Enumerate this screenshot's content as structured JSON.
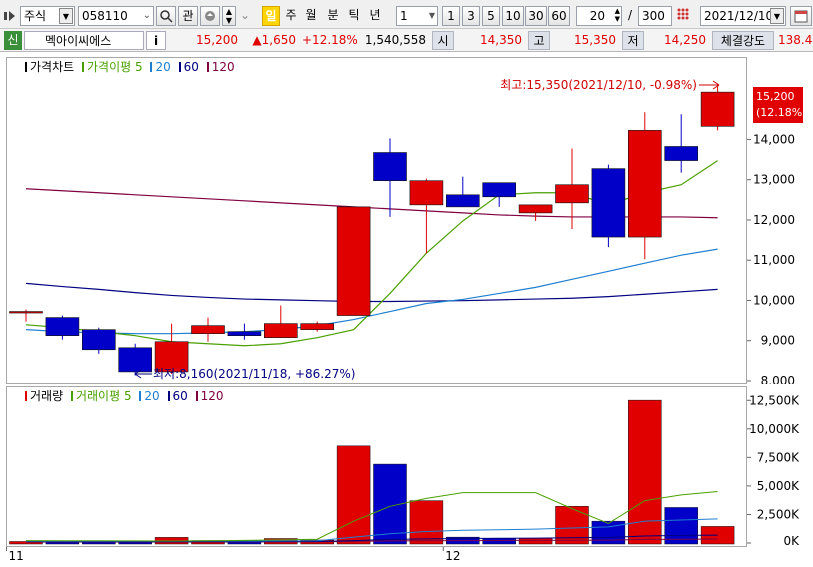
{
  "toolbar": {
    "market": "주식",
    "code": "058110",
    "fav_label": "관",
    "period_buttons": [
      "일",
      "주",
      "월",
      "분",
      "틱",
      "년"
    ],
    "interval_value": "1",
    "interval_buttons": [
      "1",
      "3",
      "5",
      "10",
      "30",
      "60"
    ],
    "display_count": "20",
    "separator": "/",
    "total_count": "300",
    "date": "2021/12/10"
  },
  "quote": {
    "badge": "신",
    "name": "멕아이씨에스",
    "info_btn": "i",
    "price": "15,200",
    "change": "▲1,650",
    "change_pct": "+12.18%",
    "volume": "1,540,558",
    "open_label": "시",
    "open": "14,350",
    "high_label": "고",
    "high": "15,350",
    "low_label": "저",
    "low": "14,250",
    "strength_label": "체결강도",
    "strength": "138.4"
  },
  "colors": {
    "up": "#e00000",
    "down": "#0000c8",
    "ma5": "#4aa000",
    "ma20": "#1e7fd0",
    "ma60": "#000080",
    "ma120": "#800040"
  },
  "chart_data": [
    {
      "type": "candlestick",
      "legend": {
        "title": "가격차트",
        "ma_prefix": "가격이평",
        "periods": [
          "5",
          "20",
          "60",
          "120"
        ]
      },
      "y_ticks": [
        "15,200",
        "14,000",
        "13,000",
        "12,000",
        "11,000",
        "10,000",
        "9,000",
        "8,000"
      ],
      "ylim": [
        7950,
        15700
      ],
      "current_price": "15,200",
      "current_pct": "(12.18%)",
      "high_annotation": "최고:15,350(2021/12/10, -0.98%)",
      "low_annotation": "최저:8,160(2021/11/18, +86.27%)",
      "candles": [
        {
          "o": 9750,
          "h": 9800,
          "l": 9500,
          "c": 9750
        },
        {
          "o": 9600,
          "h": 9650,
          "l": 9050,
          "c": 9150
        },
        {
          "o": 9300,
          "h": 9350,
          "l": 8700,
          "c": 8800
        },
        {
          "o": 8850,
          "h": 8950,
          "l": 8160,
          "c": 8250
        },
        {
          "o": 8250,
          "h": 9450,
          "l": 8200,
          "c": 9000
        },
        {
          "o": 9200,
          "h": 9600,
          "l": 9000,
          "c": 9400
        },
        {
          "o": 9250,
          "h": 9450,
          "l": 9050,
          "c": 9150
        },
        {
          "o": 9100,
          "h": 9900,
          "l": 9100,
          "c": 9450
        },
        {
          "o": 9300,
          "h": 9500,
          "l": 9250,
          "c": 9450
        },
        {
          "o": 9650,
          "h": 12350,
          "l": 9650,
          "c": 12350
        },
        {
          "o": 13700,
          "h": 14050,
          "l": 12100,
          "c": 13000
        },
        {
          "o": 12400,
          "h": 13050,
          "l": 11200,
          "c": 13000
        },
        {
          "o": 12650,
          "h": 13100,
          "l": 12350,
          "c": 12350
        },
        {
          "o": 12950,
          "h": 12950,
          "l": 12350,
          "c": 12600
        },
        {
          "o": 12200,
          "h": 12400,
          "l": 12000,
          "c": 12400
        },
        {
          "o": 12450,
          "h": 13800,
          "l": 11800,
          "c": 12900
        },
        {
          "o": 13300,
          "h": 13400,
          "l": 11350,
          "c": 11600
        },
        {
          "o": 11600,
          "h": 14700,
          "l": 11050,
          "c": 14250
        },
        {
          "o": 13850,
          "h": 14650,
          "l": 13200,
          "c": 13500
        },
        {
          "o": 14350,
          "h": 15350,
          "l": 14250,
          "c": 15200
        }
      ],
      "ma5": [
        9420,
        9350,
        9250,
        9150,
        9000,
        8950,
        8900,
        8950,
        9100,
        9300,
        10200,
        11200,
        12000,
        12650,
        12700,
        12700,
        12400,
        12700,
        12900,
        13500
      ],
      "ma20": [
        9300,
        9250,
        9220,
        9200,
        9200,
        9220,
        9250,
        9300,
        9400,
        9550,
        9750,
        9950,
        10050,
        10200,
        10350,
        10550,
        10750,
        10950,
        11150,
        11300
      ],
      "ma60": [
        10450,
        10370,
        10300,
        10220,
        10150,
        10100,
        10060,
        10040,
        10020,
        10000,
        10000,
        10010,
        10020,
        10040,
        10060,
        10080,
        10120,
        10180,
        10240,
        10300
      ],
      "ma120": [
        12800,
        12750,
        12700,
        12650,
        12600,
        12550,
        12500,
        12450,
        12400,
        12350,
        12300,
        12250,
        12200,
        12150,
        12120,
        12100,
        12100,
        12100,
        12100,
        12080
      ]
    },
    {
      "type": "bar",
      "legend": {
        "title": "거래량",
        "ma_prefix": "거래이평",
        "periods": [
          "5",
          "20",
          "60",
          "120"
        ]
      },
      "y_ticks": [
        "12,500K",
        "10,000K",
        "7,500K",
        "5,000K",
        "2,500K",
        "0K"
      ],
      "ylim": [
        0,
        12700
      ],
      "x_ticks": [
        {
          "label": "11",
          "index": 0
        },
        {
          "label": "12",
          "index": 12
        }
      ],
      "values": [
        220,
        280,
        180,
        260,
        580,
        300,
        320,
        480,
        350,
        8600,
        7000,
        3800,
        600,
        500,
        500,
        3300,
        2000,
        12600,
        3200,
        1540
      ],
      "ma5": [
        300,
        290,
        280,
        270,
        260,
        280,
        320,
        360,
        420,
        2000,
        3300,
        4000,
        4500,
        4500,
        4500,
        3100,
        1800,
        3800,
        4300,
        4600
      ],
      "ma20": [
        250,
        250,
        250,
        250,
        250,
        260,
        260,
        270,
        280,
        600,
        900,
        1100,
        1200,
        1250,
        1300,
        1400,
        1500,
        2000,
        2100,
        2200
      ],
      "ma60": [
        200,
        200,
        200,
        200,
        200,
        200,
        200,
        210,
        220,
        300,
        400,
        450,
        480,
        500,
        520,
        550,
        580,
        700,
        750,
        780
      ],
      "ma120": [
        180,
        180,
        180,
        180,
        180,
        180,
        180,
        185,
        190,
        230,
        270,
        290,
        300,
        310,
        320,
        330,
        340,
        400,
        420,
        440
      ]
    }
  ]
}
